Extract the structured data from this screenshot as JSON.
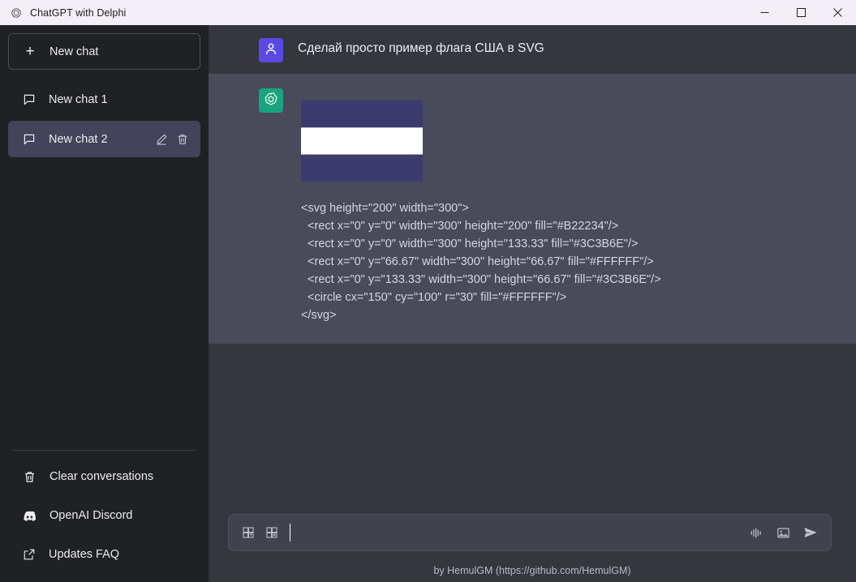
{
  "window": {
    "title": "ChatGPT with Delphi",
    "app_icon": "openai-icon",
    "controls": {
      "minimize": "—",
      "maximize": "□",
      "close": "✕"
    }
  },
  "colors": {
    "titlebar_bg": "#F3EFF6",
    "sidebar_bg": "#202123",
    "main_bg": "#36363F",
    "assistant_bg": "#494A5A",
    "selected_chat_bg": "#43435A",
    "user_avatar_bg": "#5A4AE3",
    "bot_avatar_bg": "#19A47E",
    "composer_bg": "#42424E",
    "flag_blue": "#3C3B6E",
    "flag_white": "#FFFFFF",
    "flag_red": "#B22234"
  },
  "sidebar": {
    "new_chat": {
      "label": "New chat",
      "icon": "plus-icon"
    },
    "chats": [
      {
        "label": "New chat 1",
        "icon": "chat-bubble-icon",
        "selected": false
      },
      {
        "label": "New chat 2",
        "icon": "chat-bubble-icon",
        "selected": true,
        "actions": [
          "pencil-icon",
          "trash-icon"
        ]
      }
    ],
    "footer_items": [
      {
        "label": "Clear conversations",
        "icon": "trash-icon"
      },
      {
        "label": "OpenAI Discord",
        "icon": "discord-icon"
      },
      {
        "label": "Updates  FAQ",
        "icon": "external-link-icon"
      }
    ]
  },
  "conversation": {
    "messages": [
      {
        "role": "user",
        "avatar_icon": "person-icon",
        "text": "Сделай просто пример флага США в SVG"
      },
      {
        "role": "assistant",
        "avatar_icon": "openai-logo-icon",
        "code": "<svg height=\"200\" width=\"300\">\n  <rect x=\"0\" y=\"0\" width=\"300\" height=\"200\" fill=\"#B22234\"/>\n  <rect x=\"0\" y=\"0\" width=\"300\" height=\"133.33\" fill=\"#3C3B6E\"/>\n  <rect x=\"0\" y=\"66.67\" width=\"300\" height=\"66.67\" fill=\"#FFFFFF\"/>\n  <rect x=\"0\" y=\"133.33\" width=\"300\" height=\"66.67\" fill=\"#3C3B6E\"/>\n  <circle cx=\"150\" cy=\"100\" r=\"30\" fill=\"#FFFFFF\"/>\n</svg>"
      }
    ]
  },
  "composer": {
    "value": "",
    "placeholder": "",
    "left_icons": [
      "copy-panel-icon",
      "paste-panel-icon"
    ],
    "right_icons": [
      "audio-waveform-icon",
      "image-icon",
      "send-icon"
    ]
  },
  "footer": {
    "credit": "by HemulGM (https://github.com/HemulGM)"
  }
}
